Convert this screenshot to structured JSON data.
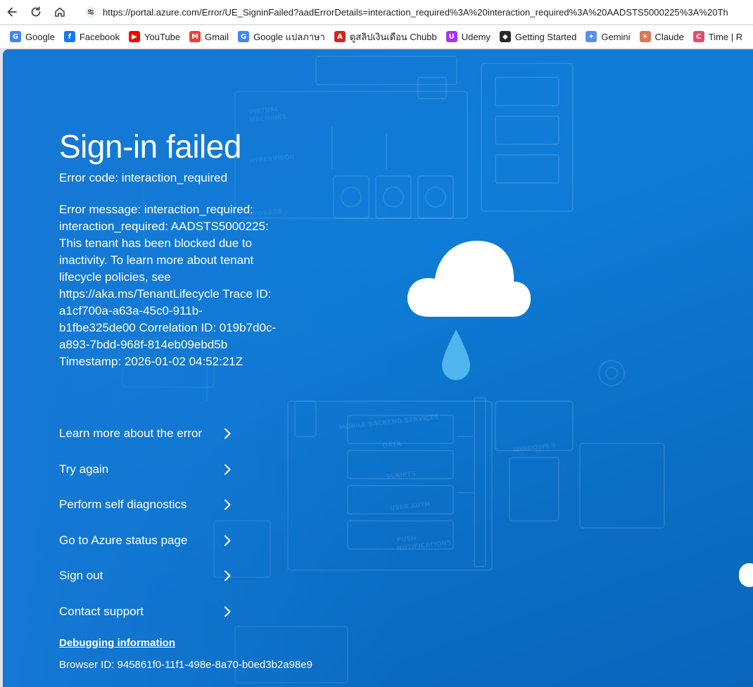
{
  "browser": {
    "url": "https://portal.azure.com/Error/UE_SigninFailed?aadErrorDetails=interaction_required%3A%20interaction_required%3A%20AADSTS5000225%3A%20Th",
    "bookmarks": [
      {
        "label": "Google",
        "icon": "google-icon",
        "color": "#4285f4",
        "glyph": "G"
      },
      {
        "label": "Facebook",
        "icon": "facebook-icon",
        "color": "#1877f2",
        "glyph": "f"
      },
      {
        "label": "YouTube",
        "icon": "youtube-icon",
        "color": "#ff0000",
        "glyph": "▶"
      },
      {
        "label": "Gmail",
        "icon": "gmail-icon",
        "color": "#ea4335",
        "glyph": "M"
      },
      {
        "label": "Google แปลภาษา",
        "icon": "google-translate-icon",
        "color": "#4285f4",
        "glyph": "G"
      },
      {
        "label": "ดูสลิปเงินเดือน Chubb",
        "icon": "adp-icon",
        "color": "#d0271d",
        "glyph": "A"
      },
      {
        "label": "Udemy",
        "icon": "udemy-icon",
        "color": "#a435f0",
        "glyph": "U"
      },
      {
        "label": "Getting Started",
        "icon": "getting-started-icon",
        "color": "#2b2b2b",
        "glyph": "◆"
      },
      {
        "label": "Gemini",
        "icon": "gemini-icon",
        "color": "#5b8def",
        "glyph": "✦"
      },
      {
        "label": "Claude",
        "icon": "claude-icon",
        "color": "#d97757",
        "glyph": "✳"
      },
      {
        "label": "Time | R",
        "icon": "time-icon",
        "color": "#e44d6a",
        "glyph": "C"
      }
    ]
  },
  "error": {
    "title": "Sign-in failed",
    "code": "Error code: interaction_required",
    "message": "Error message: interaction_required: interaction_required: AADSTS5000225: This tenant has been blocked due to inactivity. To learn more about tenant lifecycle policies, see https://aka.ms/TenantLifecycle Trace ID: a1cf700a-a63a-45c0-911b-b1fbe325de00 Correlation ID: 019b7d0c-a893-7bdd-968f-814eb09ebd5b Timestamp: 2026-01-02 04:52:21Z"
  },
  "links": [
    {
      "label": "Learn more about the error"
    },
    {
      "label": "Try again"
    },
    {
      "label": "Perform self diagnostics"
    },
    {
      "label": "Go to Azure status page"
    },
    {
      "label": "Sign out"
    },
    {
      "label": "Contact support"
    }
  ],
  "debug": {
    "title": "Debugging information",
    "browser_id": "Browser ID: 945861f0-11f1-498e-8a70-b0ed3b2a98e9"
  },
  "background_labels": [
    "VIRTUAL MACHINES",
    "HYPERVISOR",
    "STORAGE",
    "MOBILE BACKEND SERVICES",
    "DATA",
    "SCRIPTS",
    "USER AUTH",
    "PUSH NOTIFICATIONS",
    "WINDOWS 8"
  ],
  "colors": {
    "page_blue": "#0f7dd8",
    "cloud": "#ffffff",
    "raindrop": "#4fb6f0",
    "text": "#ffffff"
  }
}
